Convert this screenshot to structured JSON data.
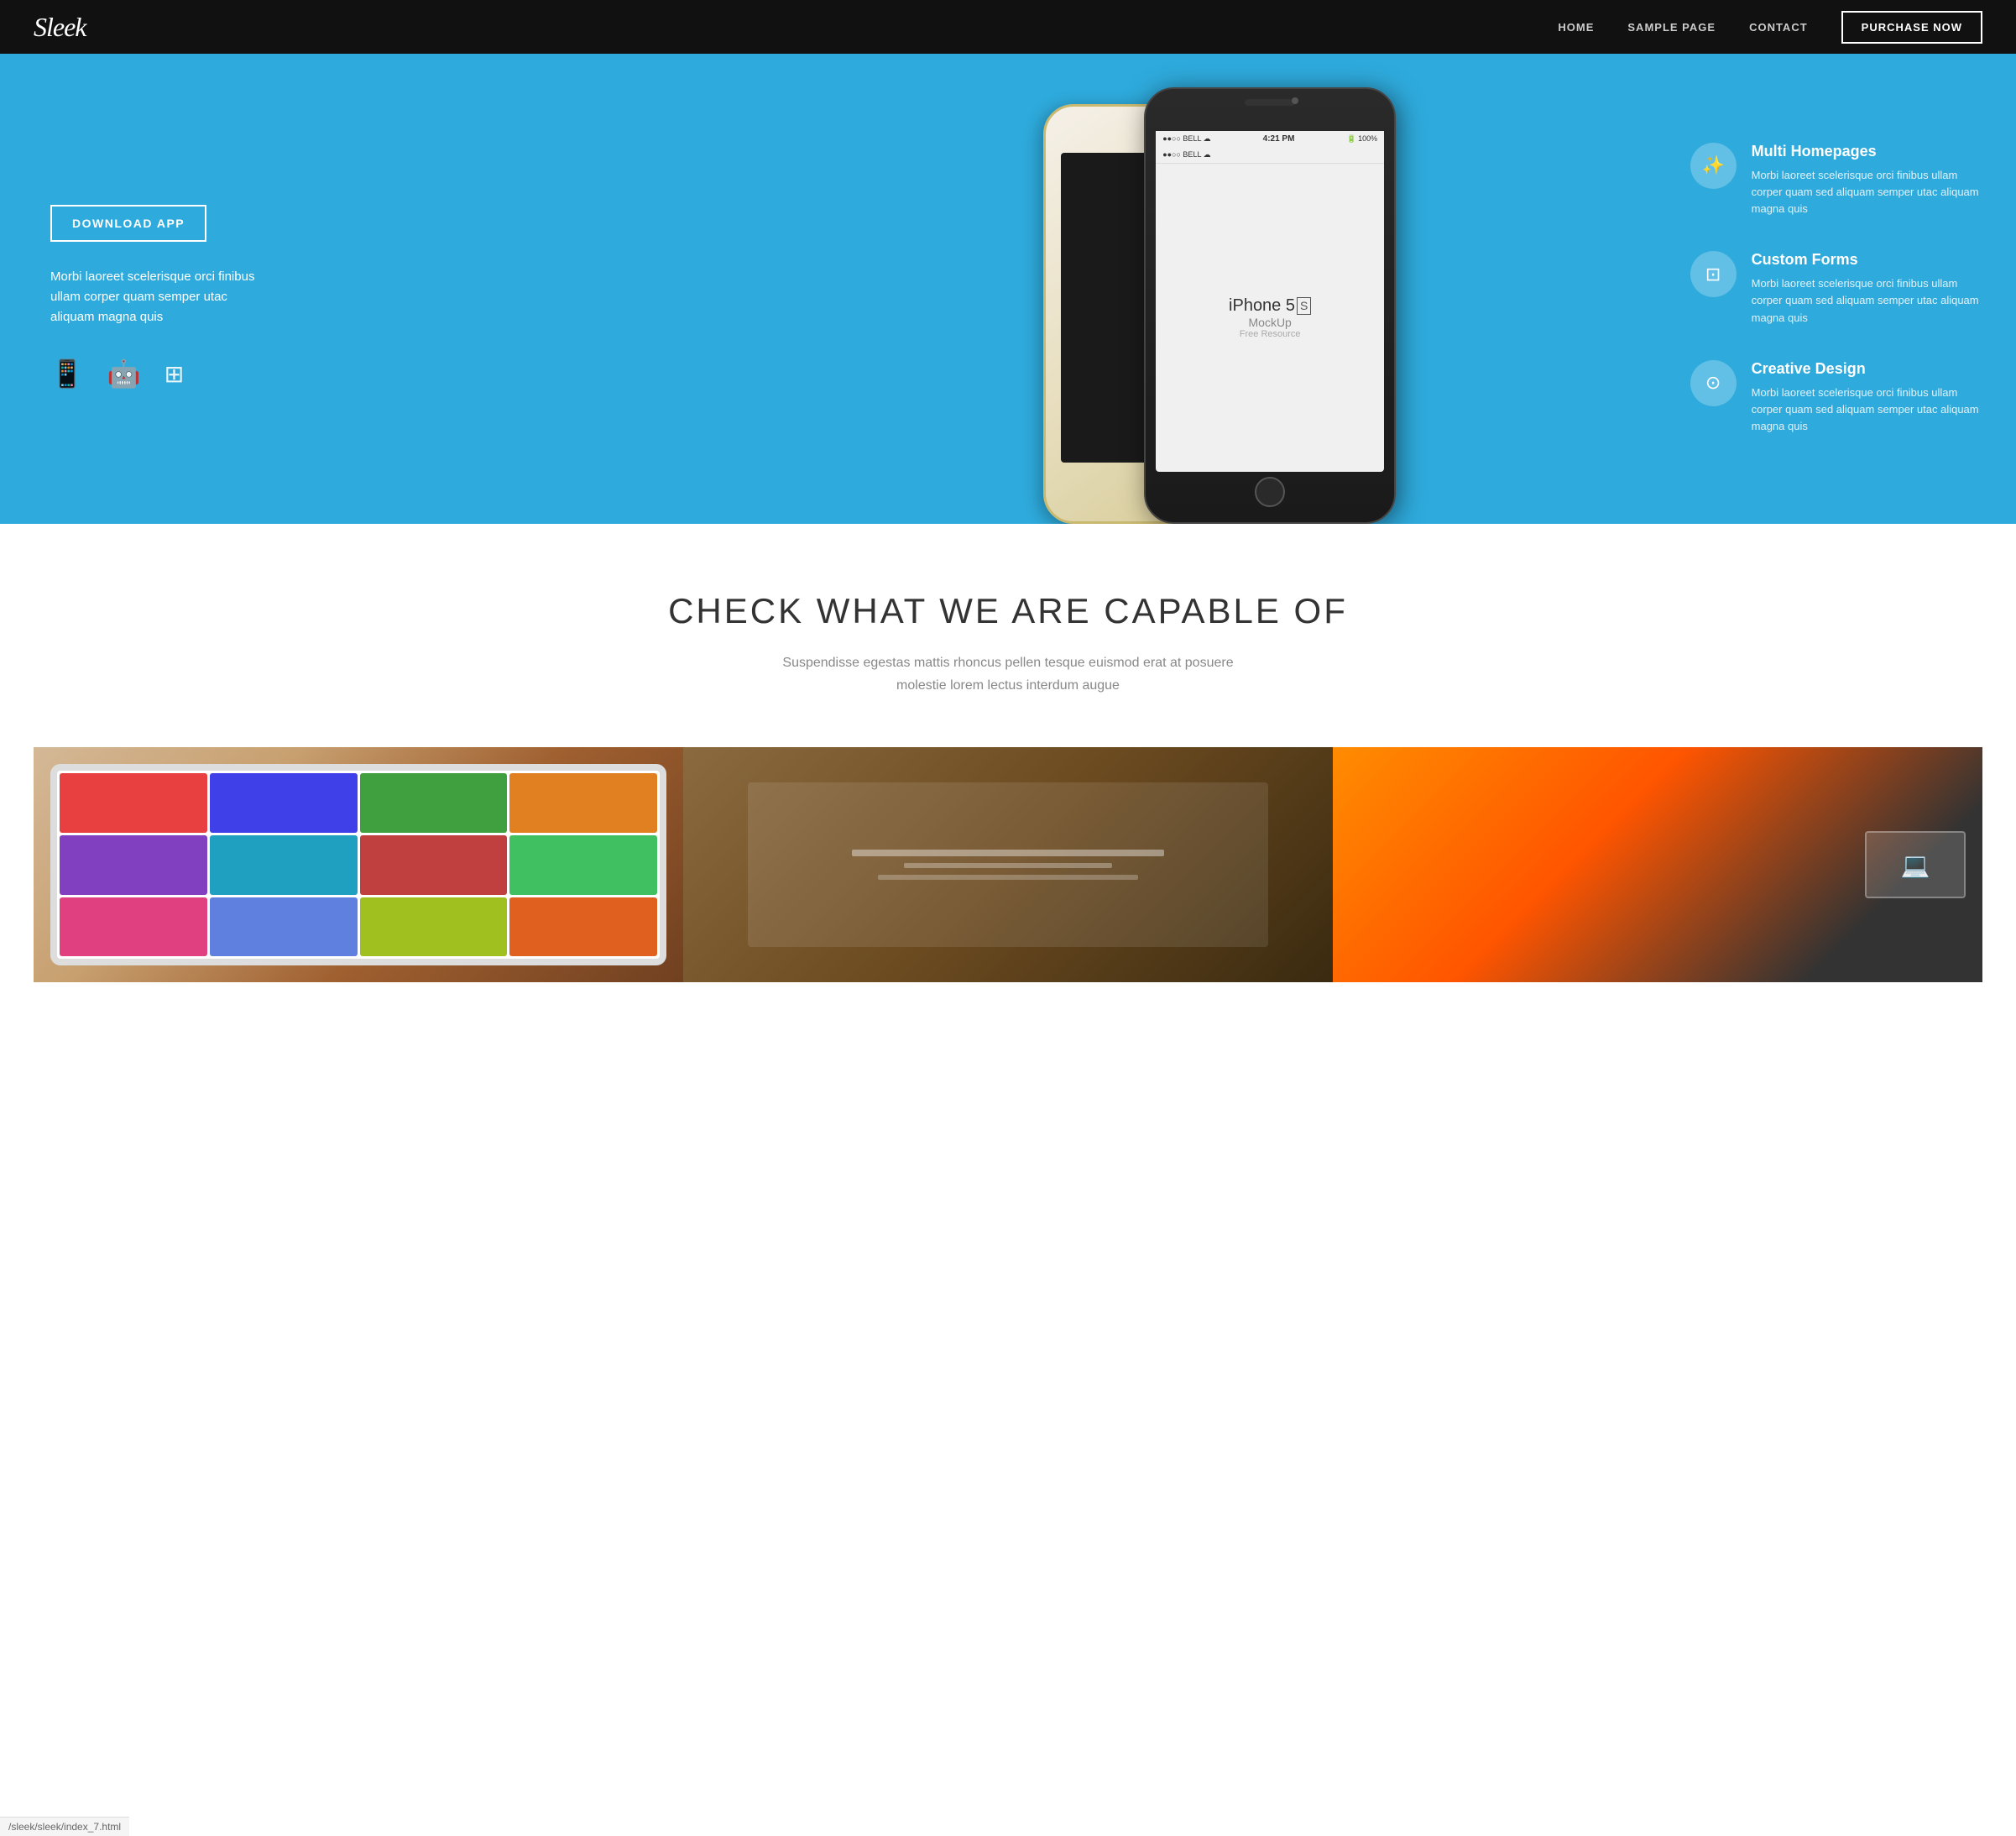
{
  "brand": {
    "name": "Sleek"
  },
  "navbar": {
    "links": [
      {
        "label": "HOME",
        "href": "#"
      },
      {
        "label": "SAMPLE PAGE",
        "href": "#"
      },
      {
        "label": "CONTACT",
        "href": "#"
      }
    ],
    "purchase_label": "PURCHASE NOW"
  },
  "hero": {
    "download_btn": "DOWNLOAD APP",
    "description": "Morbi laoreet scelerisque orci finibus ullam corper quam semper utac aliquam magna quis",
    "platform_icons": [
      "📱",
      "🤖",
      "⊞"
    ],
    "phone_model": "iPhone 5",
    "phone_s": "S",
    "phone_subtitle": "MockUp",
    "phone_subtitle2": "Free Resource",
    "phone_status_left": "●●○○ BELL  ☁",
    "phone_status_time": "4:21 PM",
    "phone_status_right": "🔋 100%"
  },
  "features": [
    {
      "icon": "✨",
      "title": "Multi Homepages",
      "description": "Morbi laoreet scelerisque orci finibus ullam corper quam sed aliquam semper utac aliquam magna quis"
    },
    {
      "icon": "⊡",
      "title": "Custom Forms",
      "description": "Morbi laoreet scelerisque orci finibus ullam corper quam sed aliquam semper utac aliquam magna quis"
    },
    {
      "icon": "⊙",
      "title": "Creative Design",
      "description": "Morbi laoreet scelerisque orci finibus ullam corper quam sed aliquam semper utac aliquam magna quis"
    }
  ],
  "capabilities": {
    "title": "CHECK WHAT WE ARE CAPABLE OF",
    "subtitle": "Suspendisse egestas mattis rhoncus pellen tesque euismod erat at posuere molestie lorem lectus interdum augue"
  },
  "portfolio": [
    {
      "alt": "Tablet with media grid"
    },
    {
      "alt": "Branding materials on wood"
    },
    {
      "alt": "Person writing with laptop"
    }
  ],
  "url_bar": {
    "text": "/sleek/sleek/index_7.html"
  }
}
